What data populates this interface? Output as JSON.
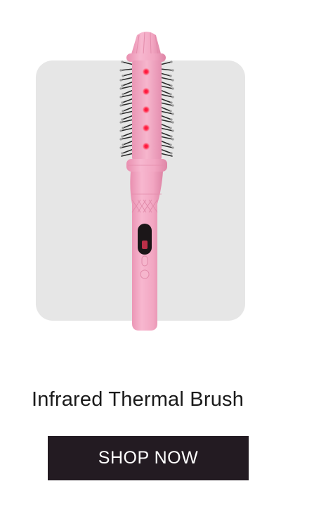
{
  "product": {
    "title": "Infrared Thermal Brush",
    "image_icon": "infrared-thermal-brush-image"
  },
  "actions": {
    "shop_label": "SHOP NOW"
  },
  "colors": {
    "panel_background": "#e6e6e6",
    "brush_pink": "#f2a9c4",
    "infrared_light": "#ff2a4a",
    "button_background": "#231b22",
    "button_text": "#ffffff"
  }
}
